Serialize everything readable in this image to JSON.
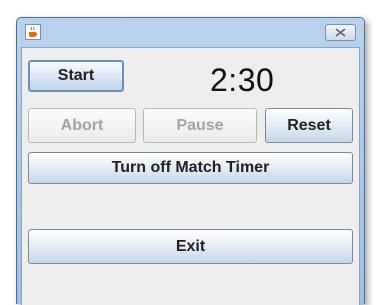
{
  "window": {
    "icon": "java-coffee-cup-icon",
    "close_icon": "close-x-icon"
  },
  "controls": {
    "start_label": "Start",
    "timer_value": "2:30",
    "abort_label": "Abort",
    "pause_label": "Pause",
    "reset_label": "Reset",
    "match_timer_label": "Turn off Match Timer",
    "exit_label": "Exit"
  },
  "colors": {
    "frame": "#b9d3ee",
    "panel": "#eeeeee",
    "disabled_text": "#a3a3a3"
  }
}
